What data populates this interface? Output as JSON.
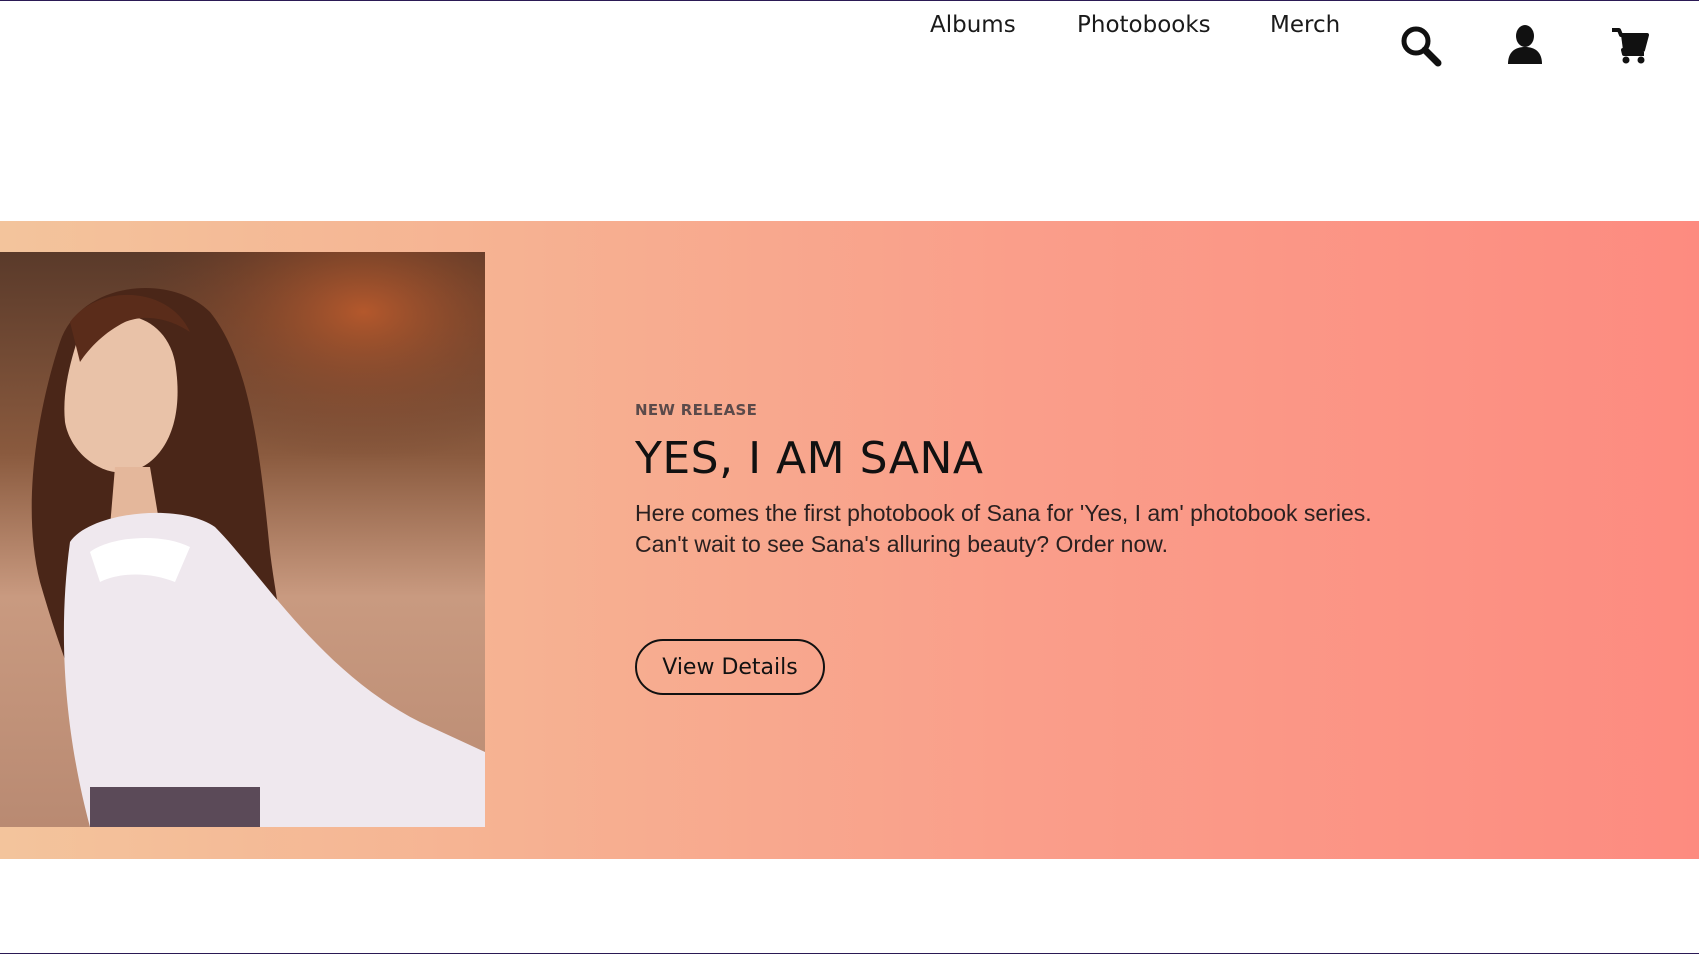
{
  "nav": {
    "items": [
      {
        "label": "Albums"
      },
      {
        "label": "Photobooks"
      },
      {
        "label": "Merch"
      }
    ],
    "icons": [
      "search-icon",
      "user-icon",
      "cart-icon"
    ]
  },
  "hero": {
    "eyebrow": "NEW RELEASE",
    "title": "YES, I AM SANA",
    "description": "Here comes the first photobook of Sana for 'Yes, I am' photobook series. Can't wait to see Sana's alluring beauty? Order now.",
    "button_label": "View Details",
    "gradient": [
      "#f3c49c",
      "#fd8b80"
    ]
  },
  "colors": {
    "accent_line": "#2b1a55",
    "text": "#111111"
  }
}
